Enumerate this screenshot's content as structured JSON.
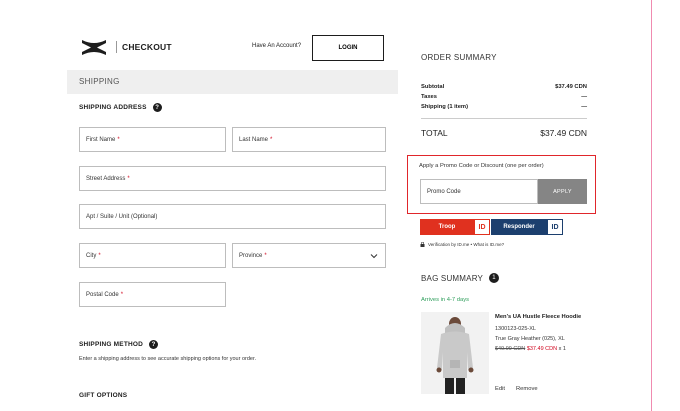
{
  "header": {
    "brand_title": "CHECKOUT",
    "have_account_text": "Have An Account?",
    "login_label": "LOGIN"
  },
  "shipping": {
    "section_title": "SHIPPING",
    "address_heading": "SHIPPING ADDRESS",
    "fields": {
      "first_name": "First Name",
      "last_name": "Last Name",
      "street_address": "Street Address",
      "apt_suite": "Apt / Suite / Unit (Optional)",
      "city": "City",
      "province": "Province",
      "postal_code": "Postal Code"
    },
    "required_mark": "*",
    "method_heading": "SHIPPING METHOD",
    "method_description": "Enter a shipping address to see accurate shipping options for your order.",
    "gift_heading": "GIFT OPTIONS"
  },
  "order_summary": {
    "title": "ORDER SUMMARY",
    "subtotal_label": "Subtotal",
    "subtotal_value": "$37.49 CDN",
    "taxes_label": "Taxes",
    "taxes_value": "—",
    "shipping_label": "Shipping (1 item)",
    "shipping_value": "—",
    "total_label": "TOTAL",
    "total_value": "$37.49 CDN"
  },
  "promo": {
    "label": "Apply a Promo Code or Discount (one per order)",
    "placeholder": "Promo Code",
    "apply_label": "APPLY"
  },
  "id_verify": {
    "troop_label": "Troop",
    "responder_label": "Responder",
    "id_badge": "ID",
    "verification_text": "Verification by ID.me • What is ID.me?"
  },
  "bag": {
    "title": "BAG SUMMARY",
    "count": "1",
    "arrival": "Arrives in 4-7 days",
    "product_name": "Men's UA Hustle Fleece Hoodie",
    "sku": "1300123-025-XL",
    "color_size": "True Gray Heather (025), XL",
    "old_price": "$49.99 CDN",
    "new_price": "$37.49 CDN",
    "quantity": "x 1",
    "edit_label": "Edit",
    "remove_label": "Remove"
  },
  "colors": {
    "promo_highlight": "#e0262b",
    "troop": "#e0311f",
    "responder": "#1c3f6e",
    "apply_button": "#858585",
    "arrival_green": "#2e9e5b",
    "sale_red": "#d0021b"
  }
}
